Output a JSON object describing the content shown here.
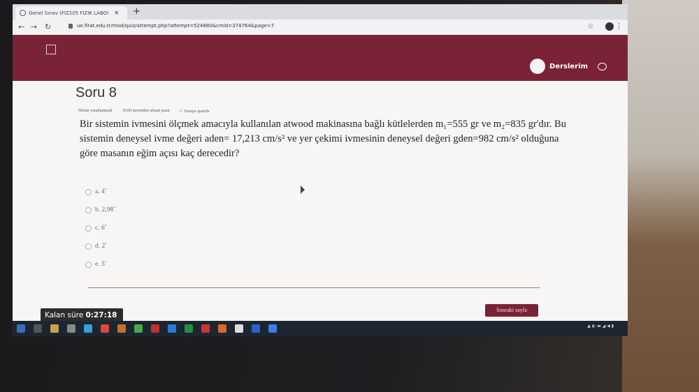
{
  "browser": {
    "tab_title": "Genel Sınav (FIZ105 FIZIK LABO!",
    "url": "ue.firat.edu.tr/mod/quiz/attempt.php?attempt=524880&cmid=374764&page=7"
  },
  "header": {
    "user_label": "Derslerim"
  },
  "question": {
    "title": "Soru 8",
    "status": "Henüz yanıtlanmadı",
    "points": "10.00 üzerinden alınan puan",
    "flag": "Soruyu işaretle",
    "text": "Bir sistemin ivmesini ölçmek amacıyla kullanılan atwood makinasına bağlı kütlelerden m₁=555 gr ve m₂=835 gr'dır. Bu sistemin deneysel ivme değeri aden= 17,213 cm/s² ve yer çekimi ivmesinin deneysel değeri gden=982 cm/s² olduğuna göre masanın eğim açısı kaç derecedir?",
    "answers": [
      "a. 4˚",
      "b. 2,98˚",
      "c. 6˚",
      "d. 2˚",
      "e. 5˚"
    ]
  },
  "footer": {
    "timer_label": "Kalan süre",
    "timer_value": "0:27:18",
    "next_button": "Sonraki sayfa"
  },
  "colors": {
    "brand": "#7a2236",
    "taskbar": "#1c2530"
  }
}
